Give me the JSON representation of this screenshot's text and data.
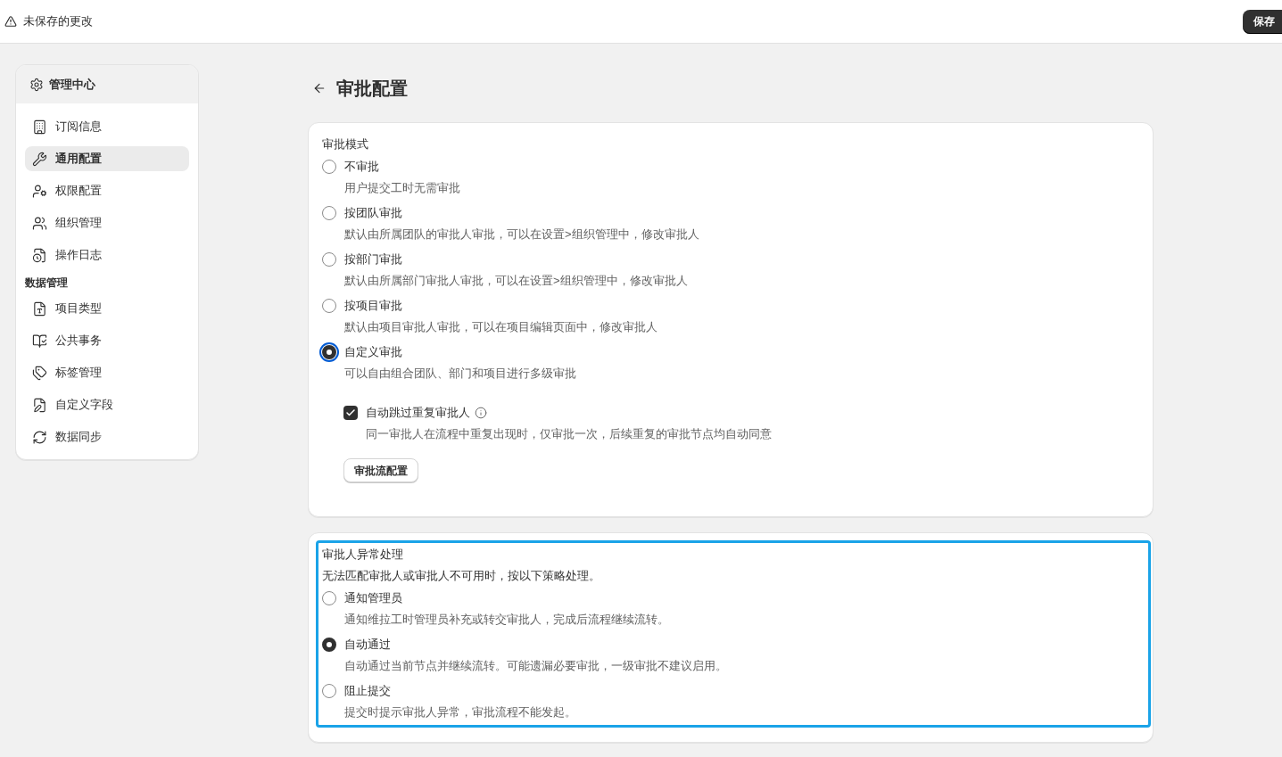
{
  "top_bar": {
    "status_text": "未保存的更改",
    "save_button": "保存"
  },
  "sidebar": {
    "title": "管理中心",
    "sections": [
      {
        "items": [
          {
            "label": "订阅信息",
            "selected": false
          },
          {
            "label": "通用配置",
            "selected": true
          },
          {
            "label": "权限配置",
            "selected": false
          },
          {
            "label": "组织管理",
            "selected": false
          },
          {
            "label": "操作日志",
            "selected": false
          }
        ]
      },
      {
        "heading": "数据管理",
        "items": [
          {
            "label": "项目类型",
            "selected": false
          },
          {
            "label": "公共事务",
            "selected": false
          },
          {
            "label": "标签管理",
            "selected": false
          },
          {
            "label": "自定义字段",
            "selected": false
          },
          {
            "label": "数据同步",
            "selected": false
          }
        ]
      }
    ]
  },
  "page_title": "审批配置",
  "approval_mode": {
    "label": "审批模式",
    "options": [
      {
        "label": "不审批",
        "description": "用户提交工时无需审批",
        "selected": false,
        "focused": false
      },
      {
        "label": "按团队审批",
        "description": "默认由所属团队的审批人审批，可以在设置>组织管理中，修改审批人",
        "selected": false,
        "focused": false
      },
      {
        "label": "按部门审批",
        "description": "默认由所属部门审批人审批，可以在设置>组织管理中，修改审批人",
        "selected": false,
        "focused": false
      },
      {
        "label": "按项目审批",
        "description": "默认由项目审批人审批，可以在项目编辑页面中，修改审批人",
        "selected": false,
        "focused": false
      },
      {
        "label": "自定义审批",
        "description": "可以自由组合团队、部门和项目进行多级审批",
        "selected": true,
        "focused": true
      }
    ],
    "skip_duplicate": {
      "label": "自动跳过重复审批人",
      "description": "同一审批人在流程中重复出现时，仅审批一次，后续重复的审批节点均自动同意",
      "checked": true
    },
    "config_button": "审批流配置"
  },
  "exception_handling": {
    "title": "审批人异常处理",
    "description": "无法匹配审批人或审批人不可用时，按以下策略处理。",
    "focused": true,
    "options": [
      {
        "label": "通知管理员",
        "description": "通知维拉工时管理员补充或转交审批人，完成后流程继续流转。",
        "selected": false
      },
      {
        "label": "自动通过",
        "description": "自动通过当前节点并继续流转。可能遗漏必要审批，一级审批不建议启用。",
        "selected": true
      },
      {
        "label": "阻止提交",
        "description": "提交时提示审批人异常，审批流程不能发起。",
        "selected": false
      }
    ]
  }
}
